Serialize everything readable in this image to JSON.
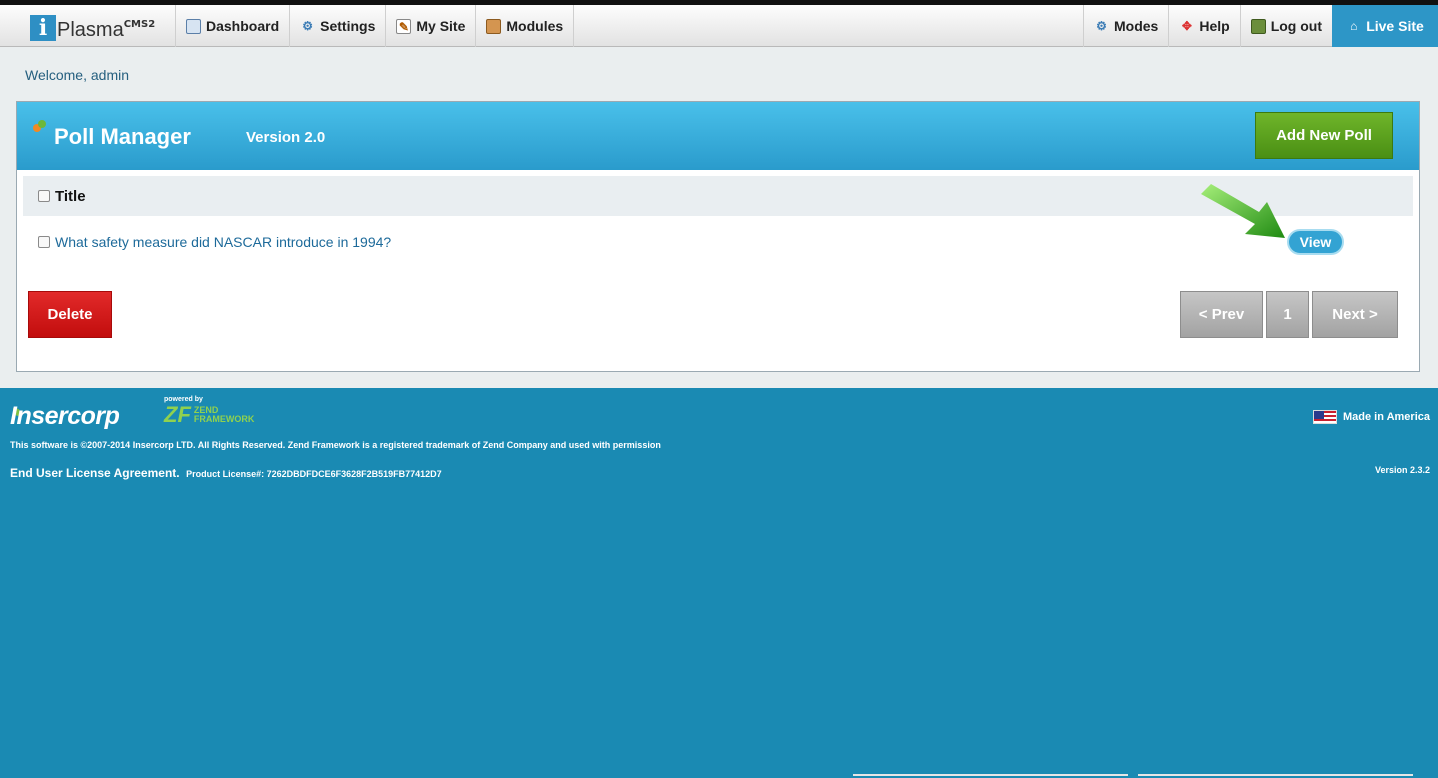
{
  "nav": {
    "logo": {
      "letter": "i",
      "text": "Plasma",
      "suffix": "CMS2"
    },
    "left": [
      {
        "label": "Dashboard",
        "icon": "dashboard-icon"
      },
      {
        "label": "Settings",
        "icon": "gear-icon"
      },
      {
        "label": "My Site",
        "icon": "edit-page-icon"
      },
      {
        "label": "Modules",
        "icon": "box-icon"
      }
    ],
    "right": [
      {
        "label": "Modes",
        "icon": "modes-icon"
      },
      {
        "label": "Help",
        "icon": "lifebuoy-icon"
      },
      {
        "label": "Log out",
        "icon": "logout-icon"
      },
      {
        "label": "Live Site",
        "icon": "home-icon"
      }
    ]
  },
  "welcome": "Welcome, admin",
  "panel": {
    "title": "Poll Manager",
    "version": "Version 2.0",
    "add_label": "Add New Poll",
    "column_title": "Title",
    "rows": [
      {
        "title": "What safety measure did NASCAR introduce in 1994?",
        "action": "View"
      }
    ],
    "delete_label": "Delete",
    "pager": {
      "prev": "< Prev",
      "page": "1",
      "next": "Next >"
    }
  },
  "footer": {
    "brand": "Insercorp",
    "powered_by": "powered by",
    "zf_mark": "ZF",
    "zf_line1": "ZEND",
    "zf_line2": "FRAMEWORK",
    "copyright": "This software is ©2007-2014 Insercorp LTD. All Rights Reserved. Zend Framework is a registered trademark of Zend Company and used with permission",
    "eula": "End User License Agreement.",
    "license": "Product License#: 7262DBDFDCE6F3628F2B519FB77412D7",
    "made_in": "Made in America",
    "version": "Version 2.3.2"
  },
  "colors": {
    "accent": "#2d96c7",
    "add": "#5ba31f",
    "delete": "#d41a1a",
    "footer": "#1a8ab3"
  }
}
